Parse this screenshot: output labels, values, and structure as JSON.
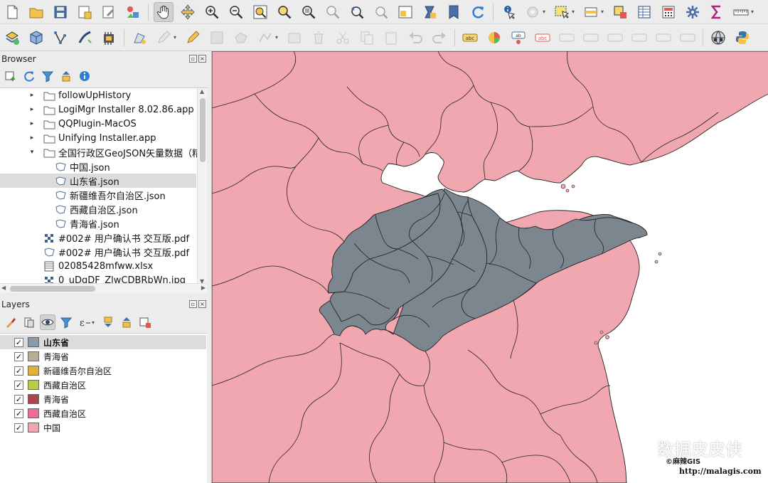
{
  "browser_panel": {
    "title": "Browser",
    "tree": [
      {
        "label": "followUpHistory",
        "kind": "folder",
        "arrow": "▸",
        "indent": 0
      },
      {
        "label": "LogiMgr Installer 8.02.86.app",
        "kind": "folder",
        "arrow": "▸",
        "indent": 0
      },
      {
        "label": "QQPlugin-MacOS",
        "kind": "folder",
        "arrow": "▸",
        "indent": 0
      },
      {
        "label": "Unifying Installer.app",
        "kind": "folder",
        "arrow": "▸",
        "indent": 0
      },
      {
        "label": "全国行政区GeoJSON矢量数据（精",
        "kind": "folder",
        "arrow": "▾",
        "indent": 0
      },
      {
        "label": "中国.json",
        "kind": "vector",
        "arrow": "",
        "indent": 1
      },
      {
        "label": "山东省.json",
        "kind": "vector",
        "arrow": "",
        "indent": 1,
        "selected": true
      },
      {
        "label": "新疆维吾尔自治区.json",
        "kind": "vector",
        "arrow": "",
        "indent": 1
      },
      {
        "label": "西藏自治区.json",
        "kind": "vector",
        "arrow": "",
        "indent": 1
      },
      {
        "label": "青海省.json",
        "kind": "vector",
        "arrow": "",
        "indent": 1
      },
      {
        "label": "#002# 用户确认书 交互版.pdf",
        "kind": "raster",
        "arrow": "",
        "indent": 0
      },
      {
        "label": "#002# 用户确认书 交互版.pdf",
        "kind": "vector",
        "arrow": "",
        "indent": 0
      },
      {
        "label": "02085428mfww.xlsx",
        "kind": "table",
        "arrow": "",
        "indent": 0
      },
      {
        "label": "0_uDgDF_ZlwCDBRbWn.jpg",
        "kind": "raster",
        "arrow": "",
        "indent": 0
      }
    ]
  },
  "layers_panel": {
    "title": "Layers",
    "layers": [
      {
        "label": "山东省",
        "color": "#8a9aa8",
        "checked": true,
        "selected": true
      },
      {
        "label": "青海省",
        "color": "#b9ad98",
        "checked": true
      },
      {
        "label": "新疆维吾尔自治区",
        "color": "#e2b33b",
        "checked": true
      },
      {
        "label": "西藏自治区",
        "color": "#b8cc44",
        "checked": true
      },
      {
        "label": "青海省",
        "color": "#b0424e",
        "checked": true
      },
      {
        "label": "西藏自治区",
        "color": "#e86f93",
        "checked": true
      },
      {
        "label": "中国",
        "color": "#f0a6b0",
        "checked": true
      }
    ]
  },
  "map": {
    "fill_china": "#f1a7b0",
    "fill_shandong": "#7c868e",
    "border": "#222222"
  },
  "watermark": {
    "main": "数据皮皮侠",
    "small": "©麻辣GIS",
    "url": "http://malagis.com"
  }
}
